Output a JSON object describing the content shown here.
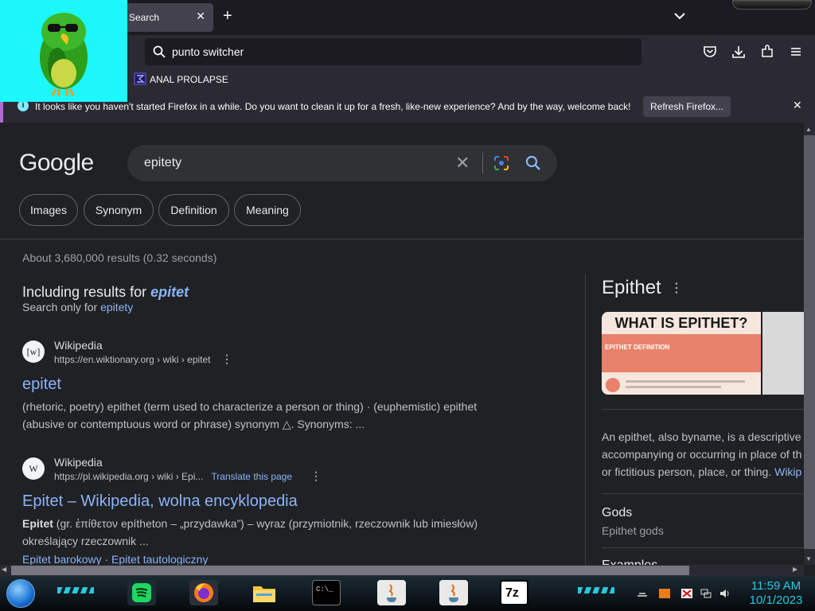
{
  "browser": {
    "tab": {
      "title": "e Search"
    },
    "urlbar": {
      "value": "punto switcher"
    },
    "bookmark": {
      "label": "ANAL PROLAPSE"
    },
    "notification": {
      "text": "It looks like you haven't started Firefox in a while. Do you want to clean it up for a fresh, like-new experience? And by the way, welcome back!",
      "button": "Refresh Firefox..."
    }
  },
  "google": {
    "logo": "Google",
    "query": "epitety",
    "chips": [
      "Images",
      "Synonym",
      "Definition",
      "Meaning"
    ],
    "stats": "About 3,680,000 results (0.32 seconds)",
    "including_prefix": "Including results for ",
    "including_term": "epitet",
    "search_only_prefix": "Search only for ",
    "search_only_term": "epitety",
    "results": [
      {
        "favicon": "[w]",
        "site": "Wikipedia",
        "url": "https://en.wiktionary.org › wiki › epitet",
        "title": "epitet",
        "snippet": "(rhetoric, poetry) epithet (term used to characterize a person or thing) · (euphemistic) epithet (abusive or contemptuous word or phrase) synonym △. Synonyms: ..."
      },
      {
        "favicon": "W",
        "site": "Wikipedia",
        "url": "https://pl.wikipedia.org › wiki › Epi...",
        "translate": "Translate this page",
        "title": "Epitet – Wikipedia, wolna encyklopedia",
        "snippet_bold": "Epitet",
        "snippet": " (gr. ἐπίθετον epítheton – „przydawka”) – wyraz (przymiotnik, rzeczownik lub imiesłów) określający rzeczownik ...",
        "links": "Epitet barokowy · Epitet tautologiczny"
      }
    ],
    "knowledge_panel": {
      "title": "Epithet",
      "image_headline": "WHAT IS EPITHET?",
      "image_label": "EPITHET DEFINITION",
      "description_lines": [
        "An epithet, also byname, is a descriptive",
        "accompanying or occurring in place of th",
        "or fictitious person, place, or thing. "
      ],
      "description_link": "Wikip",
      "gods_heading": "Gods",
      "gods_sub": "Epithet gods",
      "examples_heading": "Examples"
    }
  },
  "taskbar": {
    "time": "11:59 AM",
    "date": "10/1/2023",
    "apps": [
      "spotify-icon",
      "firefox-icon",
      "file-explorer-icon",
      "terminal-icon",
      "java-icon",
      "java-icon",
      "7zip-icon"
    ],
    "terminal_label": "C:\\_",
    "sevenzip_label": "7z"
  },
  "colors": {
    "page_bg": "#202124",
    "link": "#8ab4f8",
    "avatar_bg": "#1cf7fb",
    "clock": "#28c9e0"
  }
}
